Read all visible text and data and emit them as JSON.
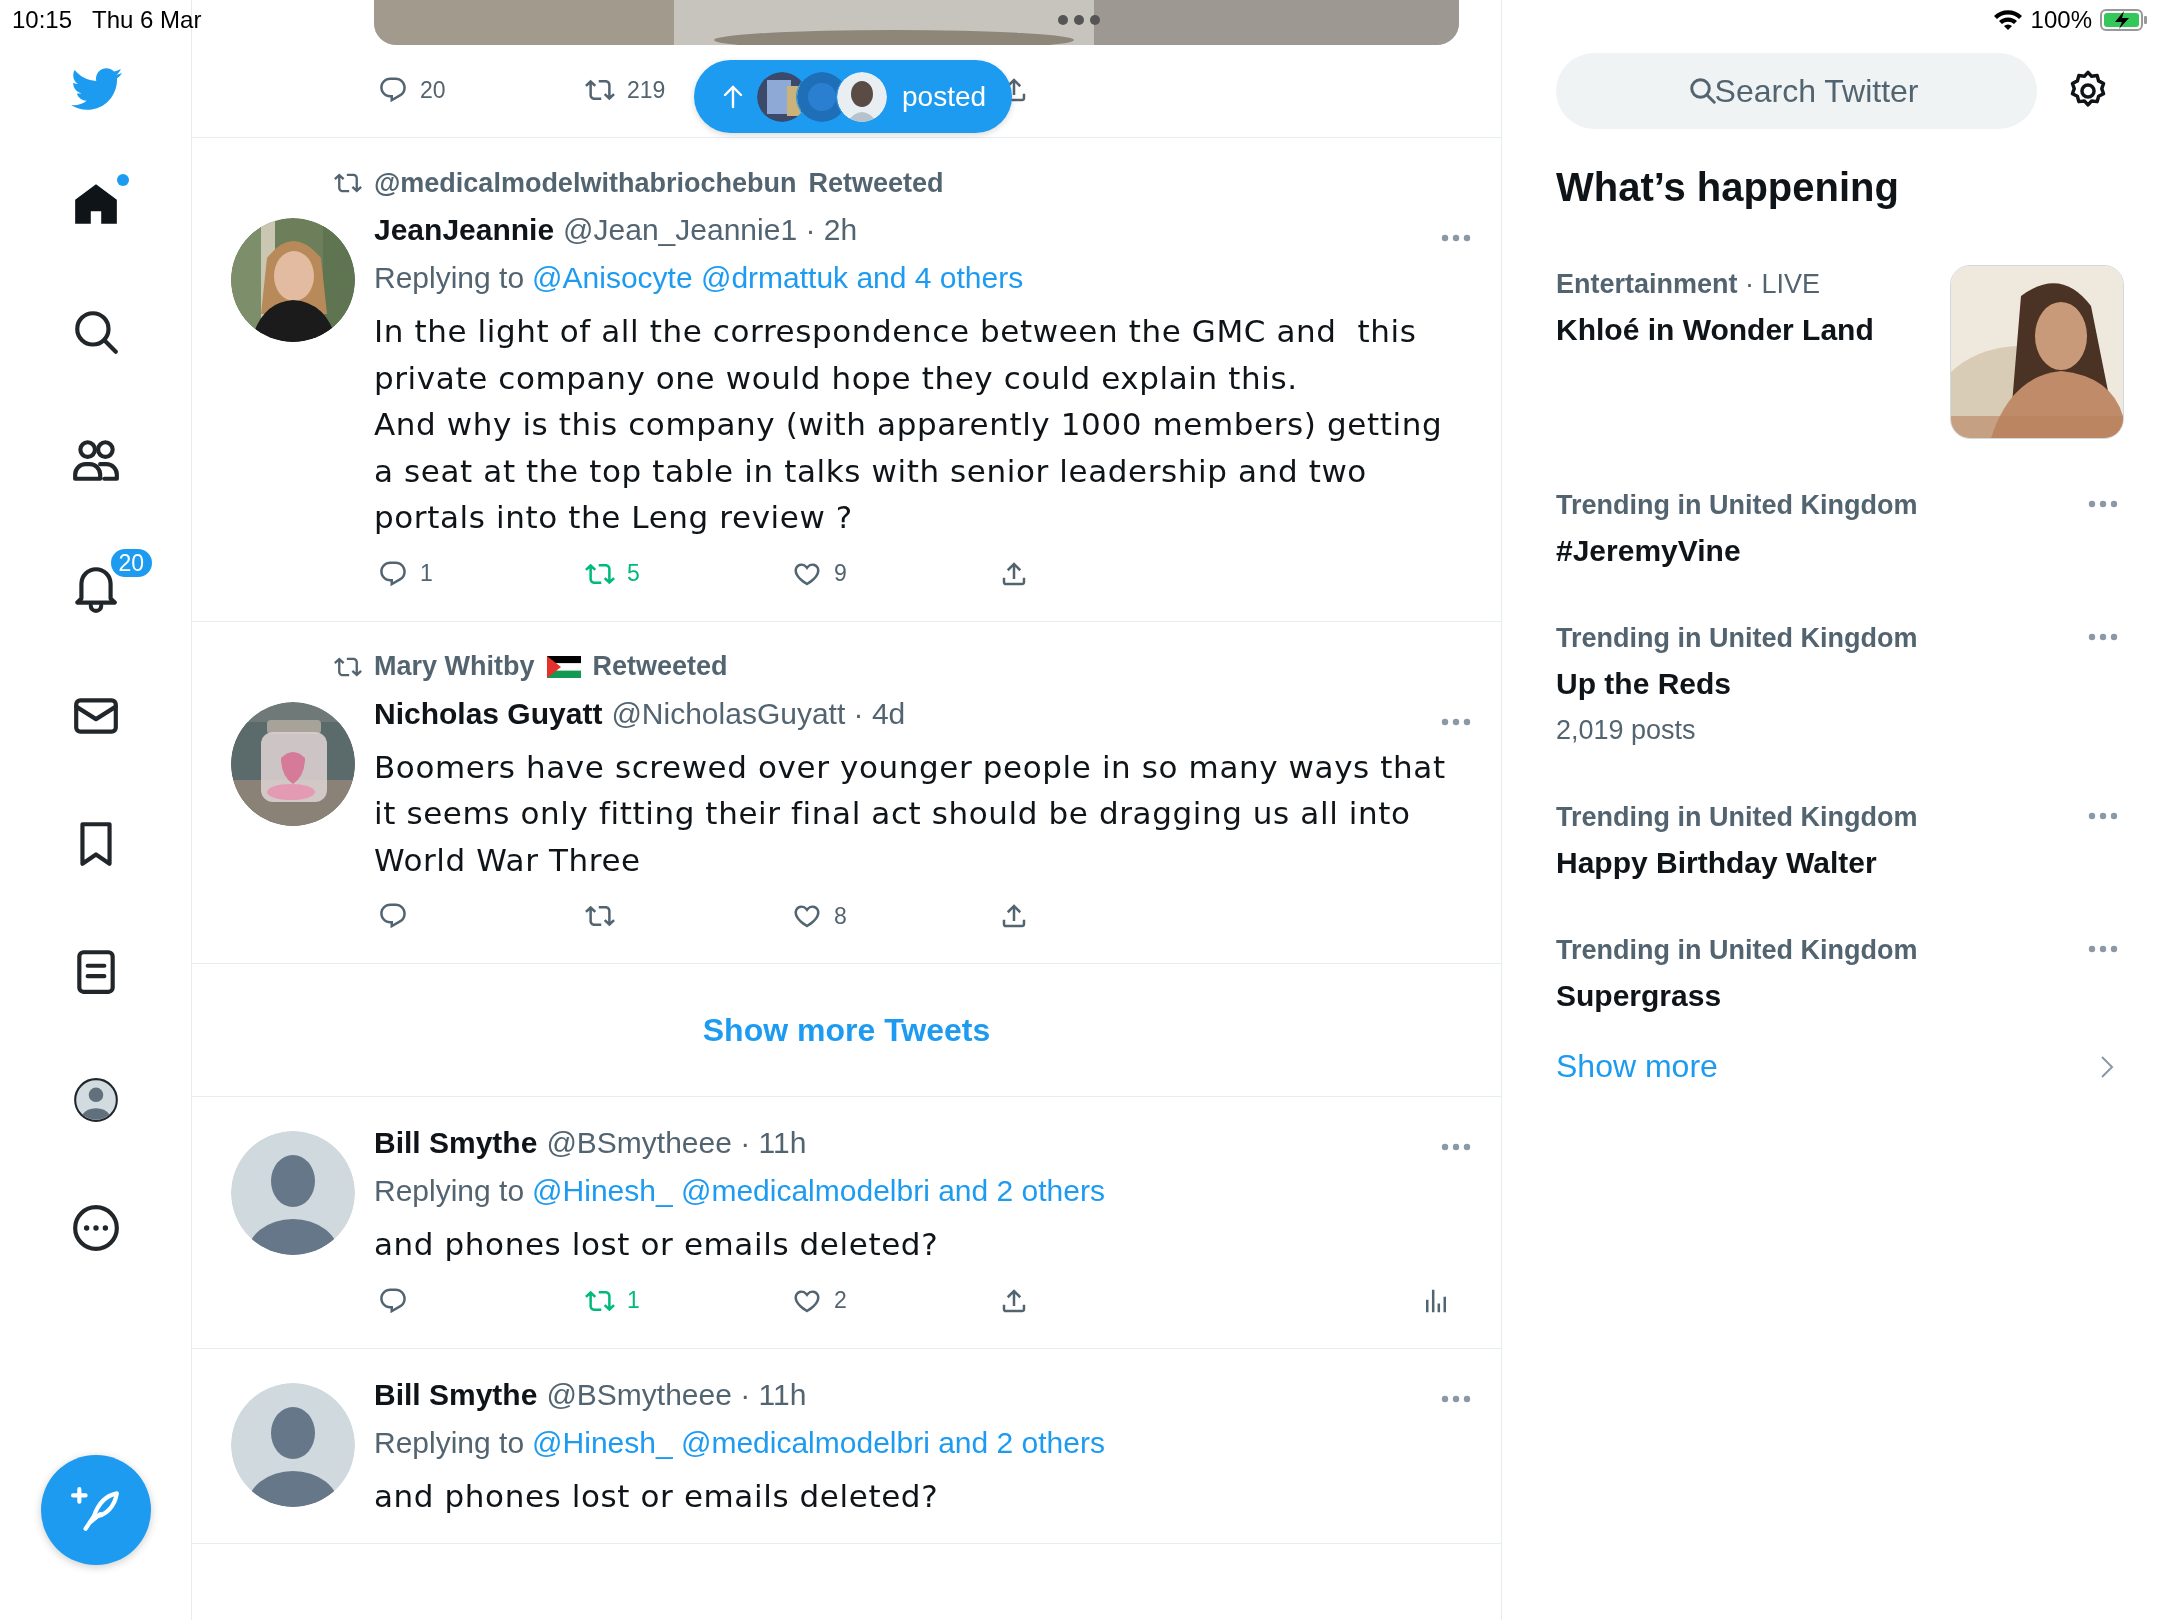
{
  "status_bar": {
    "time": "10:15",
    "date": "Thu 6 Mar",
    "battery": "100%"
  },
  "sidebar": {
    "items": [
      {
        "kind": "home",
        "selected": true,
        "unread_dot": true
      },
      {
        "kind": "explore",
        "selected": false
      },
      {
        "kind": "communities",
        "selected": false
      },
      {
        "kind": "notifications",
        "selected": false,
        "badge": "20"
      },
      {
        "kind": "messages",
        "selected": false
      },
      {
        "kind": "bookmarks",
        "selected": false
      },
      {
        "kind": "lists",
        "selected": false
      },
      {
        "kind": "profile",
        "selected": false
      },
      {
        "kind": "more",
        "selected": false
      }
    ]
  },
  "previous_tweet": {
    "replies": "20",
    "retweets": "219"
  },
  "new_posts_pill": {
    "label": "posted"
  },
  "timeline": [
    {
      "kind": "tweet",
      "retweeted_by": {
        "name": "@medicalmodelwithabriochebun",
        "suffix": "Retweeted"
      },
      "avatar_photo": true,
      "name": "JeanJeannie",
      "meta": "@Jean_Jeannie1 · 2h",
      "replying_prefix": "Replying to",
      "replying_to": "@Anisocyte @drmattuk and 4 others",
      "body": "In the light of all the correspondence between the GMC and  this private company one would hope they could explain this.\nAnd why is this company (with apparently 1000 members) getting a seat at the top table in talks with senior leadership and two portals into the Leng review ?",
      "replies": "1",
      "retweets": "5",
      "retweeted": true,
      "likes": "9"
    },
    {
      "kind": "tweet",
      "retweeted_by": {
        "name": "Mary Whitby",
        "flag": true,
        "suffix": "Retweeted"
      },
      "avatar_photo": true,
      "name": "Nicholas Guyatt",
      "meta": "@NicholasGuyatt · 4d",
      "body": "Boomers have screwed over younger people in so many ways that it seems only fitting their final act should be dragging us all into World War Three",
      "retweeted": false,
      "likes": "8"
    },
    {
      "kind": "show_more",
      "label": "Show more Tweets"
    },
    {
      "kind": "tweet",
      "avatar_photo": false,
      "name": "Bill Smythe",
      "meta": "@BSmytheee · 11h",
      "replying_prefix": "Replying to",
      "replying_to": "@Hinesh_ @medicalmodelbri and 2 others",
      "body": "and phones lost or emails deleted?",
      "retweets": "1",
      "retweeted": true,
      "likes": "2",
      "analytics": true
    },
    {
      "kind": "tweet",
      "avatar_photo": false,
      "name": "Bill Smythe",
      "meta": "@BSmytheee · 11h",
      "replying_prefix": "Replying to",
      "replying_to": "@Hinesh_ @medicalmodelbri and 2 others",
      "body": "and phones lost or emails deleted?"
    }
  ],
  "trends": {
    "search": {
      "placeholder": "Search Twitter"
    },
    "title": "What’s happening",
    "items": [
      {
        "kind": "media",
        "category": "**Entertainment** · LIVE",
        "title": "Khloé in Wonder Land"
      },
      {
        "kind": "trend",
        "category": "Trending in United Kingdom",
        "title": "#JeremyVine"
      },
      {
        "kind": "trend",
        "category": "Trending in United Kingdom",
        "title": "Up the Reds",
        "count": "2,019 posts"
      },
      {
        "kind": "trend",
        "category": "Trending in United Kingdom",
        "title": "Happy Birthday Walter"
      },
      {
        "kind": "trend",
        "category": "Trending in United Kingdom",
        "title": "Supergrass"
      }
    ],
    "show_more": "Show more"
  }
}
